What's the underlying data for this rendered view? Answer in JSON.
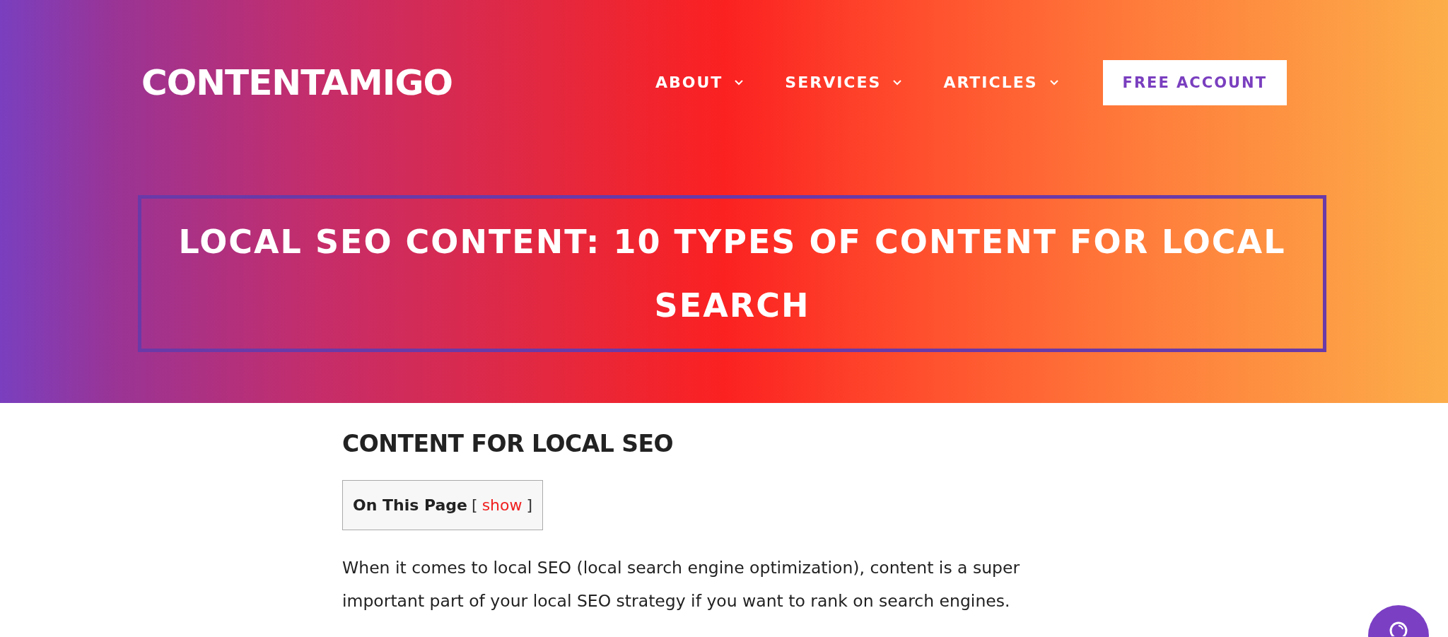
{
  "header": {
    "logo": "CONTENTAMIGO",
    "nav": [
      {
        "label": "ABOUT",
        "kind": "dropdown"
      },
      {
        "label": "SERVICES",
        "kind": "dropdown"
      },
      {
        "label": "ARTICLES",
        "kind": "dropdown"
      },
      {
        "label": "FREE ACCOUNT",
        "kind": "button"
      }
    ]
  },
  "title": "LOCAL SEO CONTENT: 10 TYPES OF CONTENT FOR LOCAL SEARCH",
  "article": {
    "heading": "CONTENT FOR LOCAL SEO",
    "toc": {
      "label": "On This Page",
      "bracket_open": "[",
      "toggle": "show",
      "bracket_close": "]"
    },
    "paragraph": "When it comes to local SEO (local search engine optimization), content is a super important part of your local SEO strategy if you want to rank on search engines."
  }
}
